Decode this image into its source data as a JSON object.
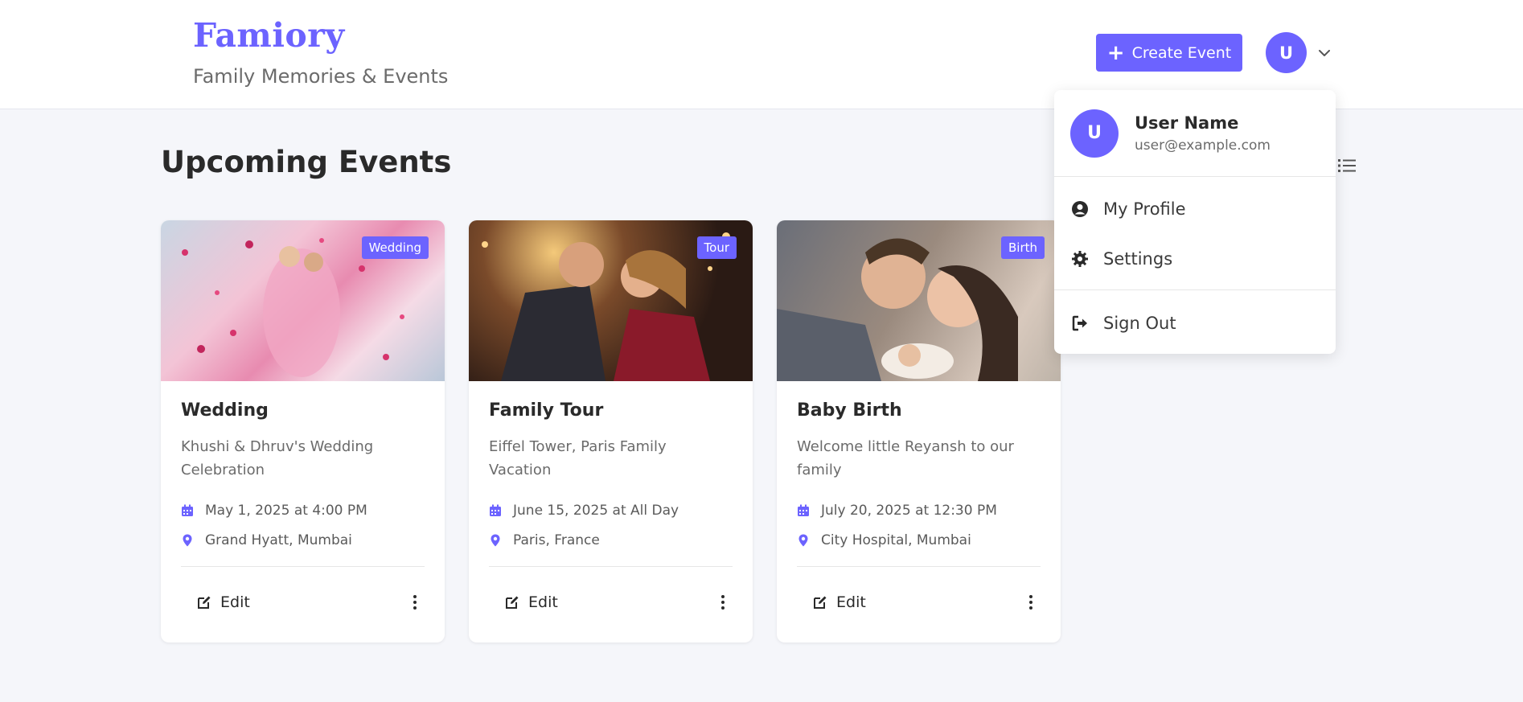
{
  "header": {
    "brand": "Famiory",
    "tagline": "Family Memories & Events",
    "create_label": "Create Event",
    "user_initial": "U"
  },
  "main": {
    "title": "Upcoming Events"
  },
  "events": [
    {
      "badge": "Wedding",
      "title": "Wedding",
      "description": "Khushi & Dhruv's Wedding Celebration",
      "datetime": "May 1, 2025 at 4:00 PM",
      "location": "Grand Hyatt, Mumbai",
      "edit_label": "Edit"
    },
    {
      "badge": "Tour",
      "title": "Family Tour",
      "description": "Eiffel Tower, Paris Family Vacation",
      "datetime": "June 15, 2025 at All Day",
      "location": "Paris, France",
      "edit_label": "Edit"
    },
    {
      "badge": "Birth",
      "title": "Baby Birth",
      "description": "Welcome little Reyansh to our family",
      "datetime": "July 20, 2025 at 12:30 PM",
      "location": "City Hospital, Mumbai",
      "edit_label": "Edit"
    }
  ],
  "user_menu": {
    "initial": "U",
    "name": "User Name",
    "email": "user@example.com",
    "items": [
      {
        "label": "My Profile",
        "icon": "user-circle-icon"
      },
      {
        "label": "Settings",
        "icon": "gear-icon"
      },
      {
        "label": "Sign Out",
        "icon": "sign-out-icon"
      }
    ]
  },
  "colors": {
    "accent": "#6c63ff",
    "background": "#f5f6fa"
  }
}
